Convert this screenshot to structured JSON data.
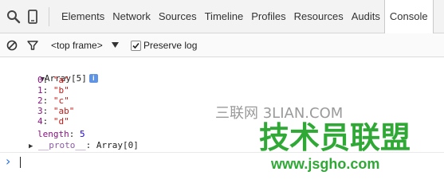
{
  "toolbar_top": {
    "tabs": [
      {
        "label": "Elements",
        "active": false
      },
      {
        "label": "Network",
        "active": false
      },
      {
        "label": "Sources",
        "active": false
      },
      {
        "label": "Timeline",
        "active": false
      },
      {
        "label": "Profiles",
        "active": false
      },
      {
        "label": "Resources",
        "active": false
      },
      {
        "label": "Audits",
        "active": false
      },
      {
        "label": "Console",
        "active": true
      }
    ]
  },
  "toolbar_console": {
    "frame_selector": "<top frame>",
    "preserve_log_label": "Preserve log",
    "preserve_log_checked": true
  },
  "console_output": {
    "array_header": "Array[5]",
    "info_badge": "i",
    "items": [
      {
        "key": "0",
        "value": "\"a\""
      },
      {
        "key": "1",
        "value": "\"b\""
      },
      {
        "key": "2",
        "value": "\"c\""
      },
      {
        "key": "3",
        "value": "\"ab\""
      },
      {
        "key": "4",
        "value": "\"d\""
      }
    ],
    "length_key": "length",
    "length_value": "5",
    "proto_key": "__proto__",
    "proto_value": "Array[0]"
  },
  "console_input": {
    "prompt": "›",
    "value": ""
  },
  "watermark": {
    "line1": "三联网 3LIAN.COM",
    "line2": "技术员联盟",
    "line3": "www.jsgho.com"
  },
  "colors": {
    "watermark_green": "#2fa836",
    "watermark_gray": "#9a9a9a"
  }
}
